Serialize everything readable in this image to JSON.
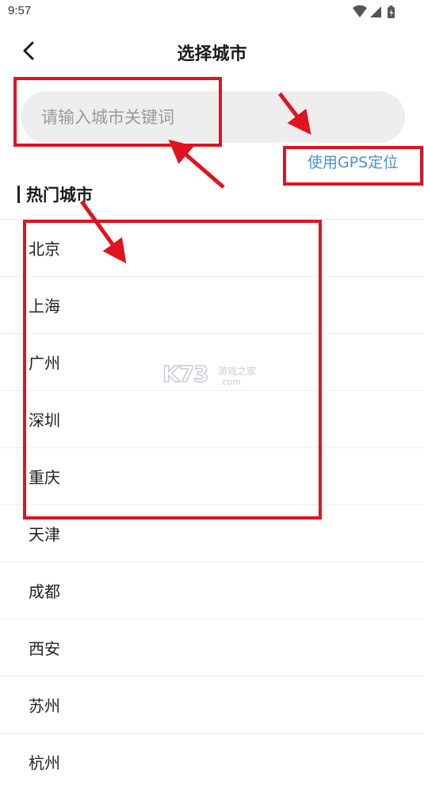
{
  "status_bar": {
    "time": "9:57"
  },
  "header": {
    "title": "选择城市",
    "back_icon": "chevron-left-icon"
  },
  "search": {
    "placeholder": "请输入城市关键词",
    "value": ""
  },
  "gps": {
    "label": "使用GPS定位"
  },
  "hot_cities": {
    "title": "热门城市",
    "items": [
      "北京",
      "上海",
      "广州",
      "深圳",
      "重庆",
      "天津",
      "成都",
      "西安",
      "苏州",
      "杭州"
    ]
  },
  "watermark": {
    "main": "K73",
    "sub": "游戏之家",
    "domain": ".com"
  },
  "colors": {
    "annotation": "#e0141e",
    "link": "#4a90d9",
    "search_bg": "#eeeeee"
  }
}
